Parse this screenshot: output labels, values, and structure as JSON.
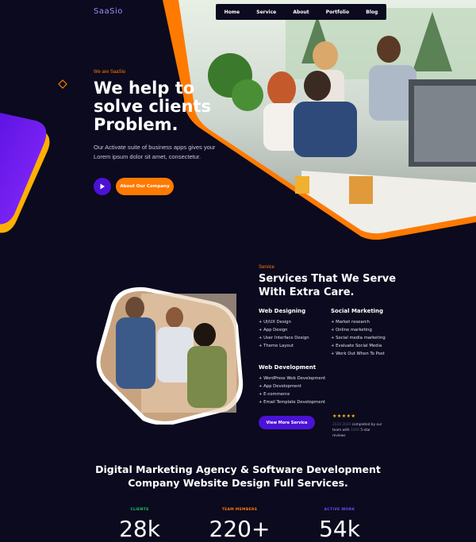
{
  "brand": {
    "logo_text": "SaaSio"
  },
  "nav": {
    "items": [
      "Home",
      "Service",
      "About",
      "Portfolio",
      "Blog"
    ]
  },
  "hero": {
    "eyebrow": "We are SaaSio",
    "title_lines": [
      "We help to",
      "solve clients",
      "Problem."
    ],
    "description": "Our Activate suite of business apps gives your Lorem ipsum dolor sit amet, consectetur.",
    "about_button": "About Our Company"
  },
  "services": {
    "eyebrow": "Service",
    "title_lines": [
      "Services That We Serve",
      "With Extra Care."
    ],
    "web_designing": {
      "heading": "Web Designing",
      "items": [
        "UI/UX Design",
        "App Design",
        "User Interface Design",
        "Theme Layout"
      ]
    },
    "social_marketing": {
      "heading": "Social Marketing",
      "items": [
        "Market research",
        "Online marketing",
        "Social media marketing",
        "Evaluate Social Media",
        "Work Out When To Post"
      ]
    },
    "web_development": {
      "heading": "Web Development",
      "items": [
        "WordPress Web Development",
        "App Development",
        "E-commerce",
        "Email Template Development"
      ]
    },
    "more_button": "View More Service",
    "rating": {
      "stars": "★★★★★",
      "value": 5,
      "review_lead": "2020 2020",
      "review_mid": "completed by our team with",
      "review_count": "1000",
      "review_tail": "5-star reviews"
    }
  },
  "agency": {
    "title_lines": [
      "Digital Marketing Agency & Software Development",
      "Company Website Design Full Services."
    ]
  },
  "stats": [
    {
      "label": "CLIENTS",
      "value": "28k",
      "color": "#22c55e"
    },
    {
      "label": "TEAM MEMBERS",
      "value": "220+",
      "color": "#ff7a00"
    },
    {
      "label": "ACTIVE WORK",
      "value": "54k",
      "color": "#6d4bff"
    }
  ],
  "colors": {
    "background": "#0b0a1e",
    "accent_orange": "#ff7a00",
    "accent_purple": "#4b12d6"
  },
  "icons": {
    "play": "play-icon",
    "star": "star-icon",
    "diamond": "diamond-outline-icon"
  }
}
